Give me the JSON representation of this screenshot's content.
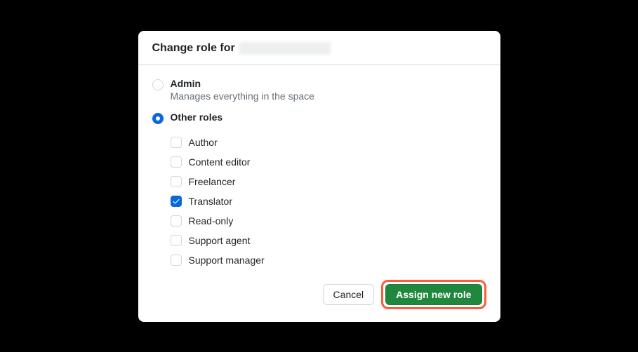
{
  "header": {
    "title_prefix": "Change role for"
  },
  "roles": {
    "admin": {
      "label": "Admin",
      "description": "Manages everything in the space",
      "selected": false
    },
    "other": {
      "label": "Other roles",
      "selected": true,
      "items": [
        {
          "label": "Author",
          "checked": false
        },
        {
          "label": "Content editor",
          "checked": false
        },
        {
          "label": "Freelancer",
          "checked": false
        },
        {
          "label": "Translator",
          "checked": true
        },
        {
          "label": "Read-only",
          "checked": false
        },
        {
          "label": "Support agent",
          "checked": false
        },
        {
          "label": "Support manager",
          "checked": false
        }
      ]
    }
  },
  "footer": {
    "cancel": "Cancel",
    "confirm": "Assign new role"
  }
}
